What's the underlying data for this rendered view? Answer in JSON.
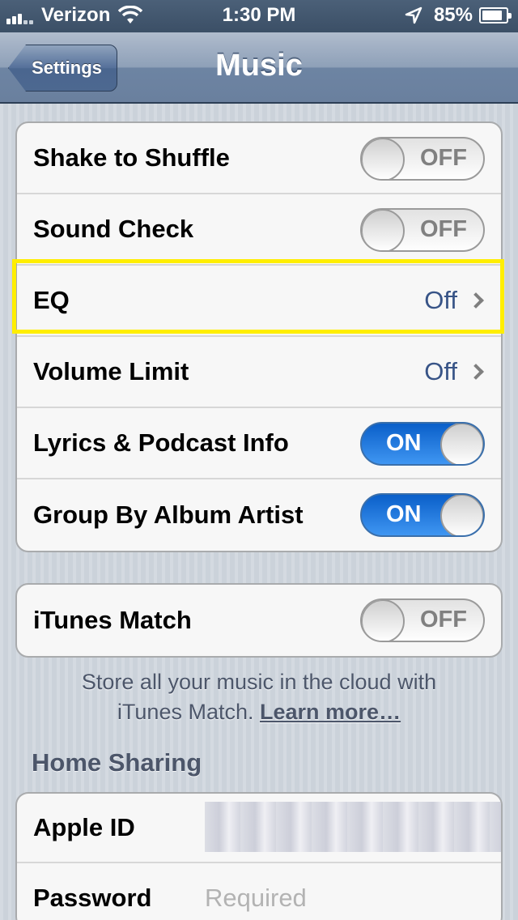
{
  "status_bar": {
    "carrier": "Verizon",
    "time": "1:30 PM",
    "battery": "85%",
    "battery_level": 0.85
  },
  "nav": {
    "back_label": "Settings",
    "title": "Music"
  },
  "group1": [
    {
      "label": "Shake to Shuffle",
      "type": "switch",
      "state": "OFF"
    },
    {
      "label": "Sound Check",
      "type": "switch",
      "state": "OFF"
    },
    {
      "label": "EQ",
      "type": "disclosure",
      "value": "Off"
    },
    {
      "label": "Volume Limit",
      "type": "disclosure",
      "value": "Off"
    },
    {
      "label": "Lyrics & Podcast Info",
      "type": "switch",
      "state": "ON"
    },
    {
      "label": "Group By Album Artist",
      "type": "switch",
      "state": "ON"
    }
  ],
  "group2": {
    "label": "iTunes Match",
    "state": "OFF"
  },
  "note": {
    "text_line1": "Store all your music in the cloud with",
    "text_line2": "iTunes Match.",
    "link": "Learn more…"
  },
  "home_sharing": {
    "header": "Home Sharing",
    "apple_id_label": "Apple ID",
    "password_label": "Password",
    "password_placeholder": "Required"
  },
  "colors": {
    "highlight": "#ffee00",
    "switch_on": "#1a6fd9",
    "value_text": "#385487"
  }
}
